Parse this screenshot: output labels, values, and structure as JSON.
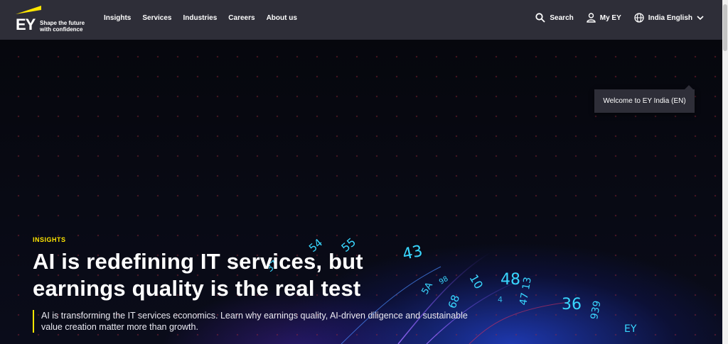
{
  "header": {
    "logo_text": "EY",
    "tagline_line1": "Shape the future",
    "tagline_line2": "with confidence",
    "nav": [
      "Insights",
      "Services",
      "Industries",
      "Careers",
      "About us"
    ],
    "search_label": "Search",
    "myey_label": "My EY",
    "locale_label": "India English"
  },
  "popup": {
    "text": "Welcome to EY India (EN)"
  },
  "hero": {
    "eyebrow": "INSIGHTS",
    "headline": "AI is redefining IT services, but earnings quality is the real test",
    "description": "AI is transforming the IT services economics. Learn why earnings quality, AI-driven diligence and sustainable value creation matter more than growth."
  },
  "colors": {
    "accent": "#ffe600",
    "header_bg": "#2e2e38"
  }
}
